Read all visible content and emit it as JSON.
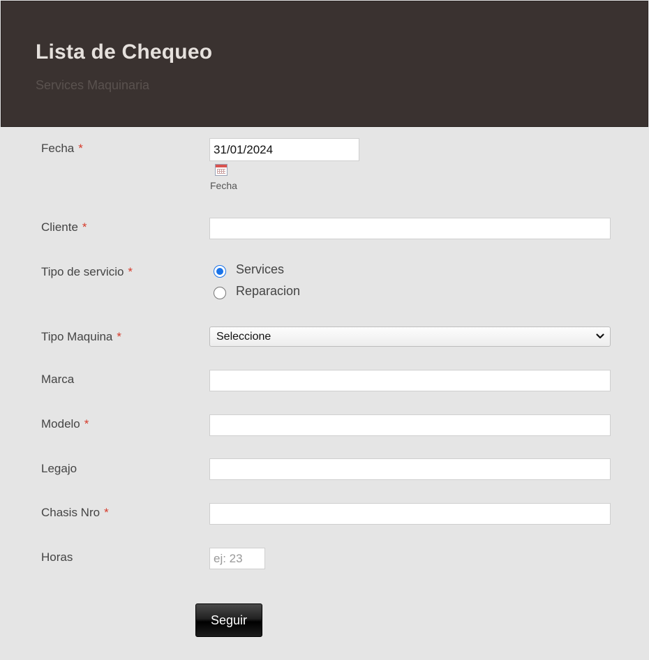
{
  "header": {
    "title": "Lista de Chequeo",
    "subtitle": "Services Maquinaria"
  },
  "form": {
    "required_mark": "*",
    "fecha": {
      "label": "Fecha",
      "value": "31/01/2024",
      "sublabel": "Fecha"
    },
    "cliente": {
      "label": "Cliente",
      "value": ""
    },
    "tipo_servicio": {
      "label": "Tipo de servicio",
      "options": [
        {
          "label": "Services",
          "checked": true
        },
        {
          "label": "Reparacion",
          "checked": false
        }
      ]
    },
    "tipo_maquina": {
      "label": "Tipo Maquina",
      "selected": "Seleccione"
    },
    "marca": {
      "label": "Marca",
      "value": ""
    },
    "modelo": {
      "label": "Modelo",
      "value": ""
    },
    "legajo": {
      "label": "Legajo",
      "value": ""
    },
    "chasis": {
      "label": "Chasis Nro",
      "value": ""
    },
    "horas": {
      "label": "Horas",
      "placeholder": "ej: 23"
    },
    "submit_label": "Seguir"
  },
  "colors": {
    "header_bg": "#3a3230",
    "required": "#d63a2a",
    "radio_accent": "#1a73e8"
  },
  "icons": {
    "calendar": "calendar-icon",
    "dropdown": "chevron-down-icon"
  }
}
